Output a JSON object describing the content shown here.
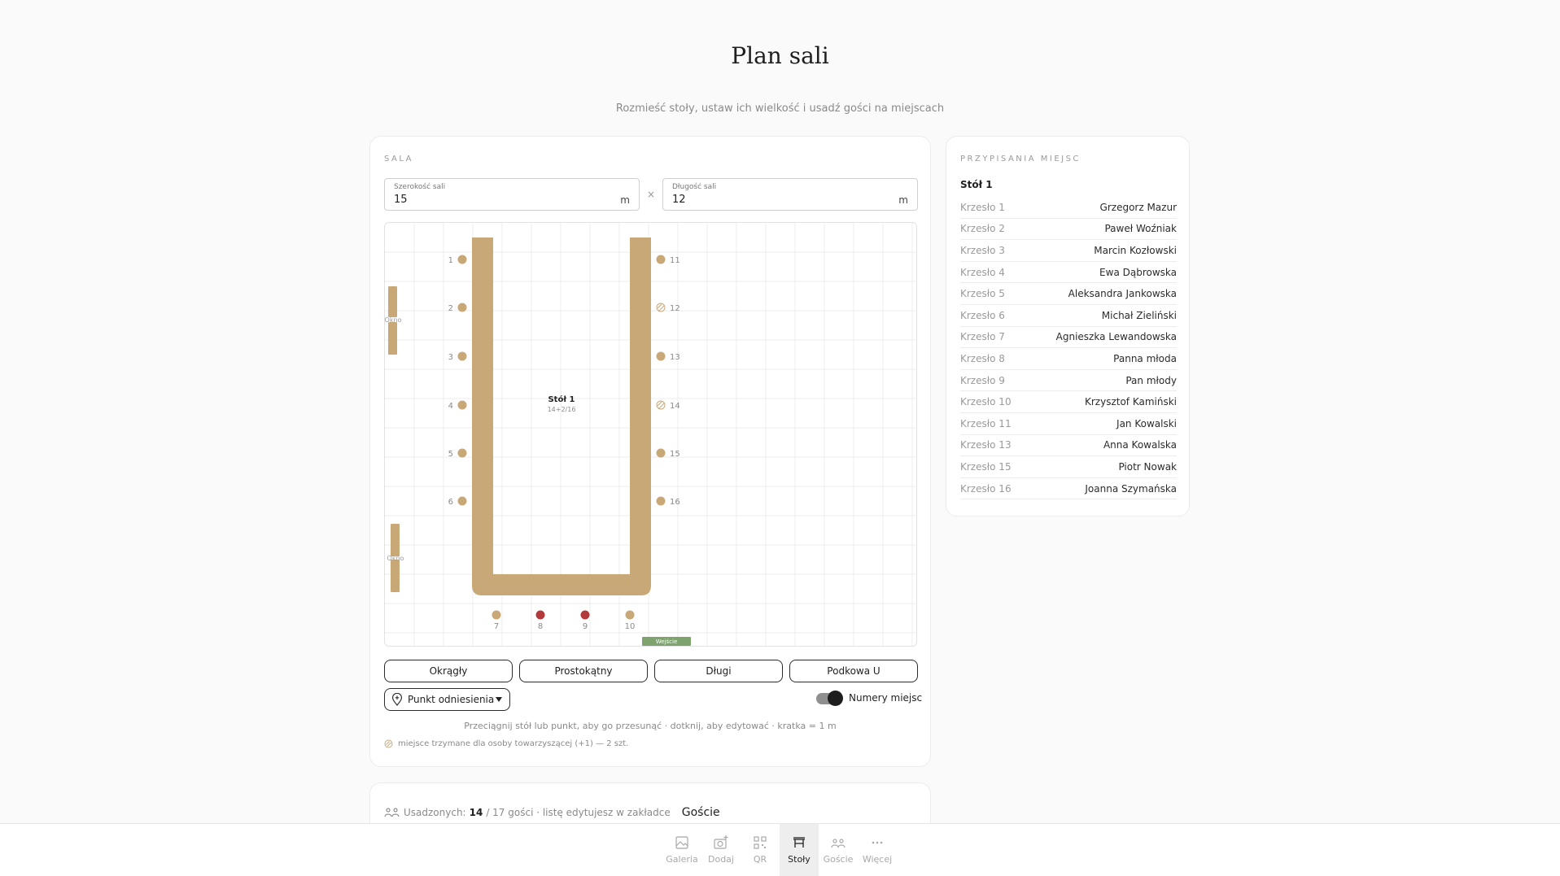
{
  "header": {
    "title": "Plan sali",
    "subtitle": "Rozmieść stoły, ustaw ich wielkość i usadź gości na miejscach"
  },
  "hall": {
    "section_label": "SALA",
    "width_label": "Szerokość sali",
    "width_value": "15",
    "length_label": "Długość sali",
    "length_value": "12",
    "unit": "m",
    "times": "×",
    "window_label": "Okno",
    "entrance_label": "Wejście",
    "table": {
      "name": "Stół 1",
      "capacity": "14+2/16"
    },
    "left_seats": [
      "1",
      "2",
      "3",
      "4",
      "5",
      "6"
    ],
    "right_seats": [
      "11",
      "12",
      "13",
      "14",
      "15",
      "16"
    ],
    "bottom_seats": [
      "7",
      "8",
      "9",
      "10"
    ],
    "shape_buttons": [
      "Okrągły",
      "Prostokątny",
      "Długi",
      "Podkowa U"
    ],
    "reference_point_label": "Punkt odniesienia",
    "seat_numbers_label": "Numery miejsc",
    "seat_numbers_on": true,
    "hint": "Przeciągnij stół lub punkt, aby go przesunąć · dotknij, aby edytować · kratka = 1 m",
    "legend": "miejsce trzymane dla osoby towarzyszącej (+1) — 2 szt.",
    "colors": {
      "table": "#c8a877",
      "highlight": "#b23a3a",
      "entrance": "#7ea36f",
      "grid": "#ececec"
    }
  },
  "assignments": {
    "section_label": "PRZYPISANIA MIEJSC",
    "table_name": "Stół 1",
    "rows": [
      {
        "seat": "Krzesło 1",
        "guest": "Grzegorz Mazur"
      },
      {
        "seat": "Krzesło 2",
        "guest": "Paweł Woźniak"
      },
      {
        "seat": "Krzesło 3",
        "guest": "Marcin Kozłowski"
      },
      {
        "seat": "Krzesło 4",
        "guest": "Ewa Dąbrowska"
      },
      {
        "seat": "Krzesło 5",
        "guest": "Aleksandra Jankowska"
      },
      {
        "seat": "Krzesło 6",
        "guest": "Michał Zieliński"
      },
      {
        "seat": "Krzesło 7",
        "guest": "Agnieszka Lewandowska"
      },
      {
        "seat": "Krzesło 8",
        "guest": "Panna młoda"
      },
      {
        "seat": "Krzesło 9",
        "guest": "Pan młody"
      },
      {
        "seat": "Krzesło 10",
        "guest": "Krzysztof Kamiński"
      },
      {
        "seat": "Krzesło 11",
        "guest": "Jan Kowalski"
      },
      {
        "seat": "Krzesło 13",
        "guest": "Anna Kowalska"
      },
      {
        "seat": "Krzesło 15",
        "guest": "Piotr Nowak"
      },
      {
        "seat": "Krzesło 16",
        "guest": "Joanna Szymańska"
      }
    ]
  },
  "summary": {
    "label": "Usadzonych:",
    "seated": "14",
    "rest": "/ 17 gości · listę edytujesz w zakładce",
    "link": "Goście"
  },
  "nav": {
    "items": [
      {
        "label": "Galeria",
        "icon": "gallery-icon"
      },
      {
        "label": "Dodaj",
        "icon": "camera-add-icon"
      },
      {
        "label": "QR",
        "icon": "qr-icon"
      },
      {
        "label": "Stoły",
        "icon": "table-icon",
        "active": true
      },
      {
        "label": "Goście",
        "icon": "guests-icon"
      },
      {
        "label": "Więcej",
        "icon": "more-icon"
      }
    ]
  }
}
